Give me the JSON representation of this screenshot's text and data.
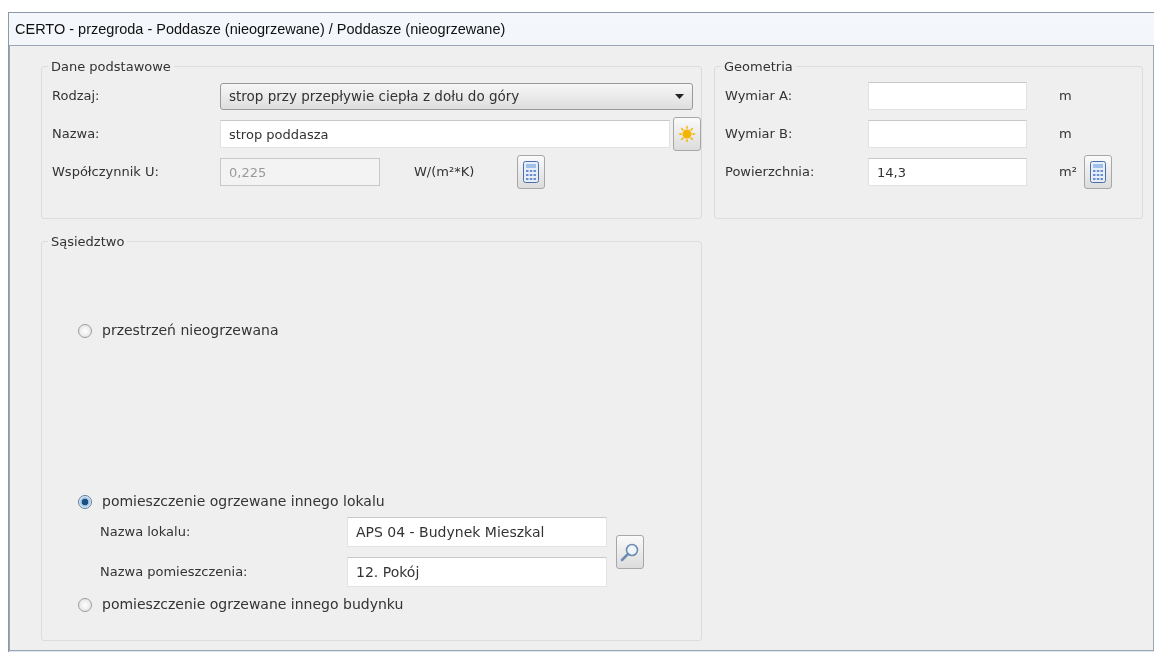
{
  "window": {
    "title": "CERTO - przegroda - Poddasze (nieogrzewane) / Poddasze (nieogrzewane)"
  },
  "basic": {
    "title": "Dane podstawowe",
    "type": {
      "label": "Rodzaj:",
      "value": "strop przy przepływie ciepła z dołu do góry"
    },
    "name": {
      "label": "Nazwa:",
      "value": "strop poddasza"
    },
    "u": {
      "label": "Współczynnik U:",
      "value": "0,225",
      "unit": "W/(m²*K)",
      "disabled": true
    }
  },
  "geometry": {
    "title": "Geometria",
    "fields": [
      {
        "label": "Wymiar A:",
        "unit": "m",
        "kind": "plain"
      },
      {
        "label": "Wymiar B:",
        "unit": "m",
        "kind": "plain"
      },
      {
        "label": "Powierzchnia:",
        "value": "14,3",
        "unit": "m²",
        "kind": "computed"
      }
    ]
  },
  "neighbourhood": {
    "title": "Sąsiedztwo",
    "options": [
      {
        "label": "przestrzeń nieogrzewana",
        "selected": false
      },
      {
        "label": "pomieszczenie ogrzewane innego lokalu",
        "selected": true,
        "fields": [
          {
            "label": "Nazwa lokalu:",
            "value": "APS 04 - Budynek Mieszkal"
          },
          {
            "label": "Nazwa pomieszczenia:",
            "value": "12. Pokój"
          }
        ]
      },
      {
        "label": "pomieszczenie ogrzewane innego budynku",
        "selected": false
      }
    ]
  }
}
